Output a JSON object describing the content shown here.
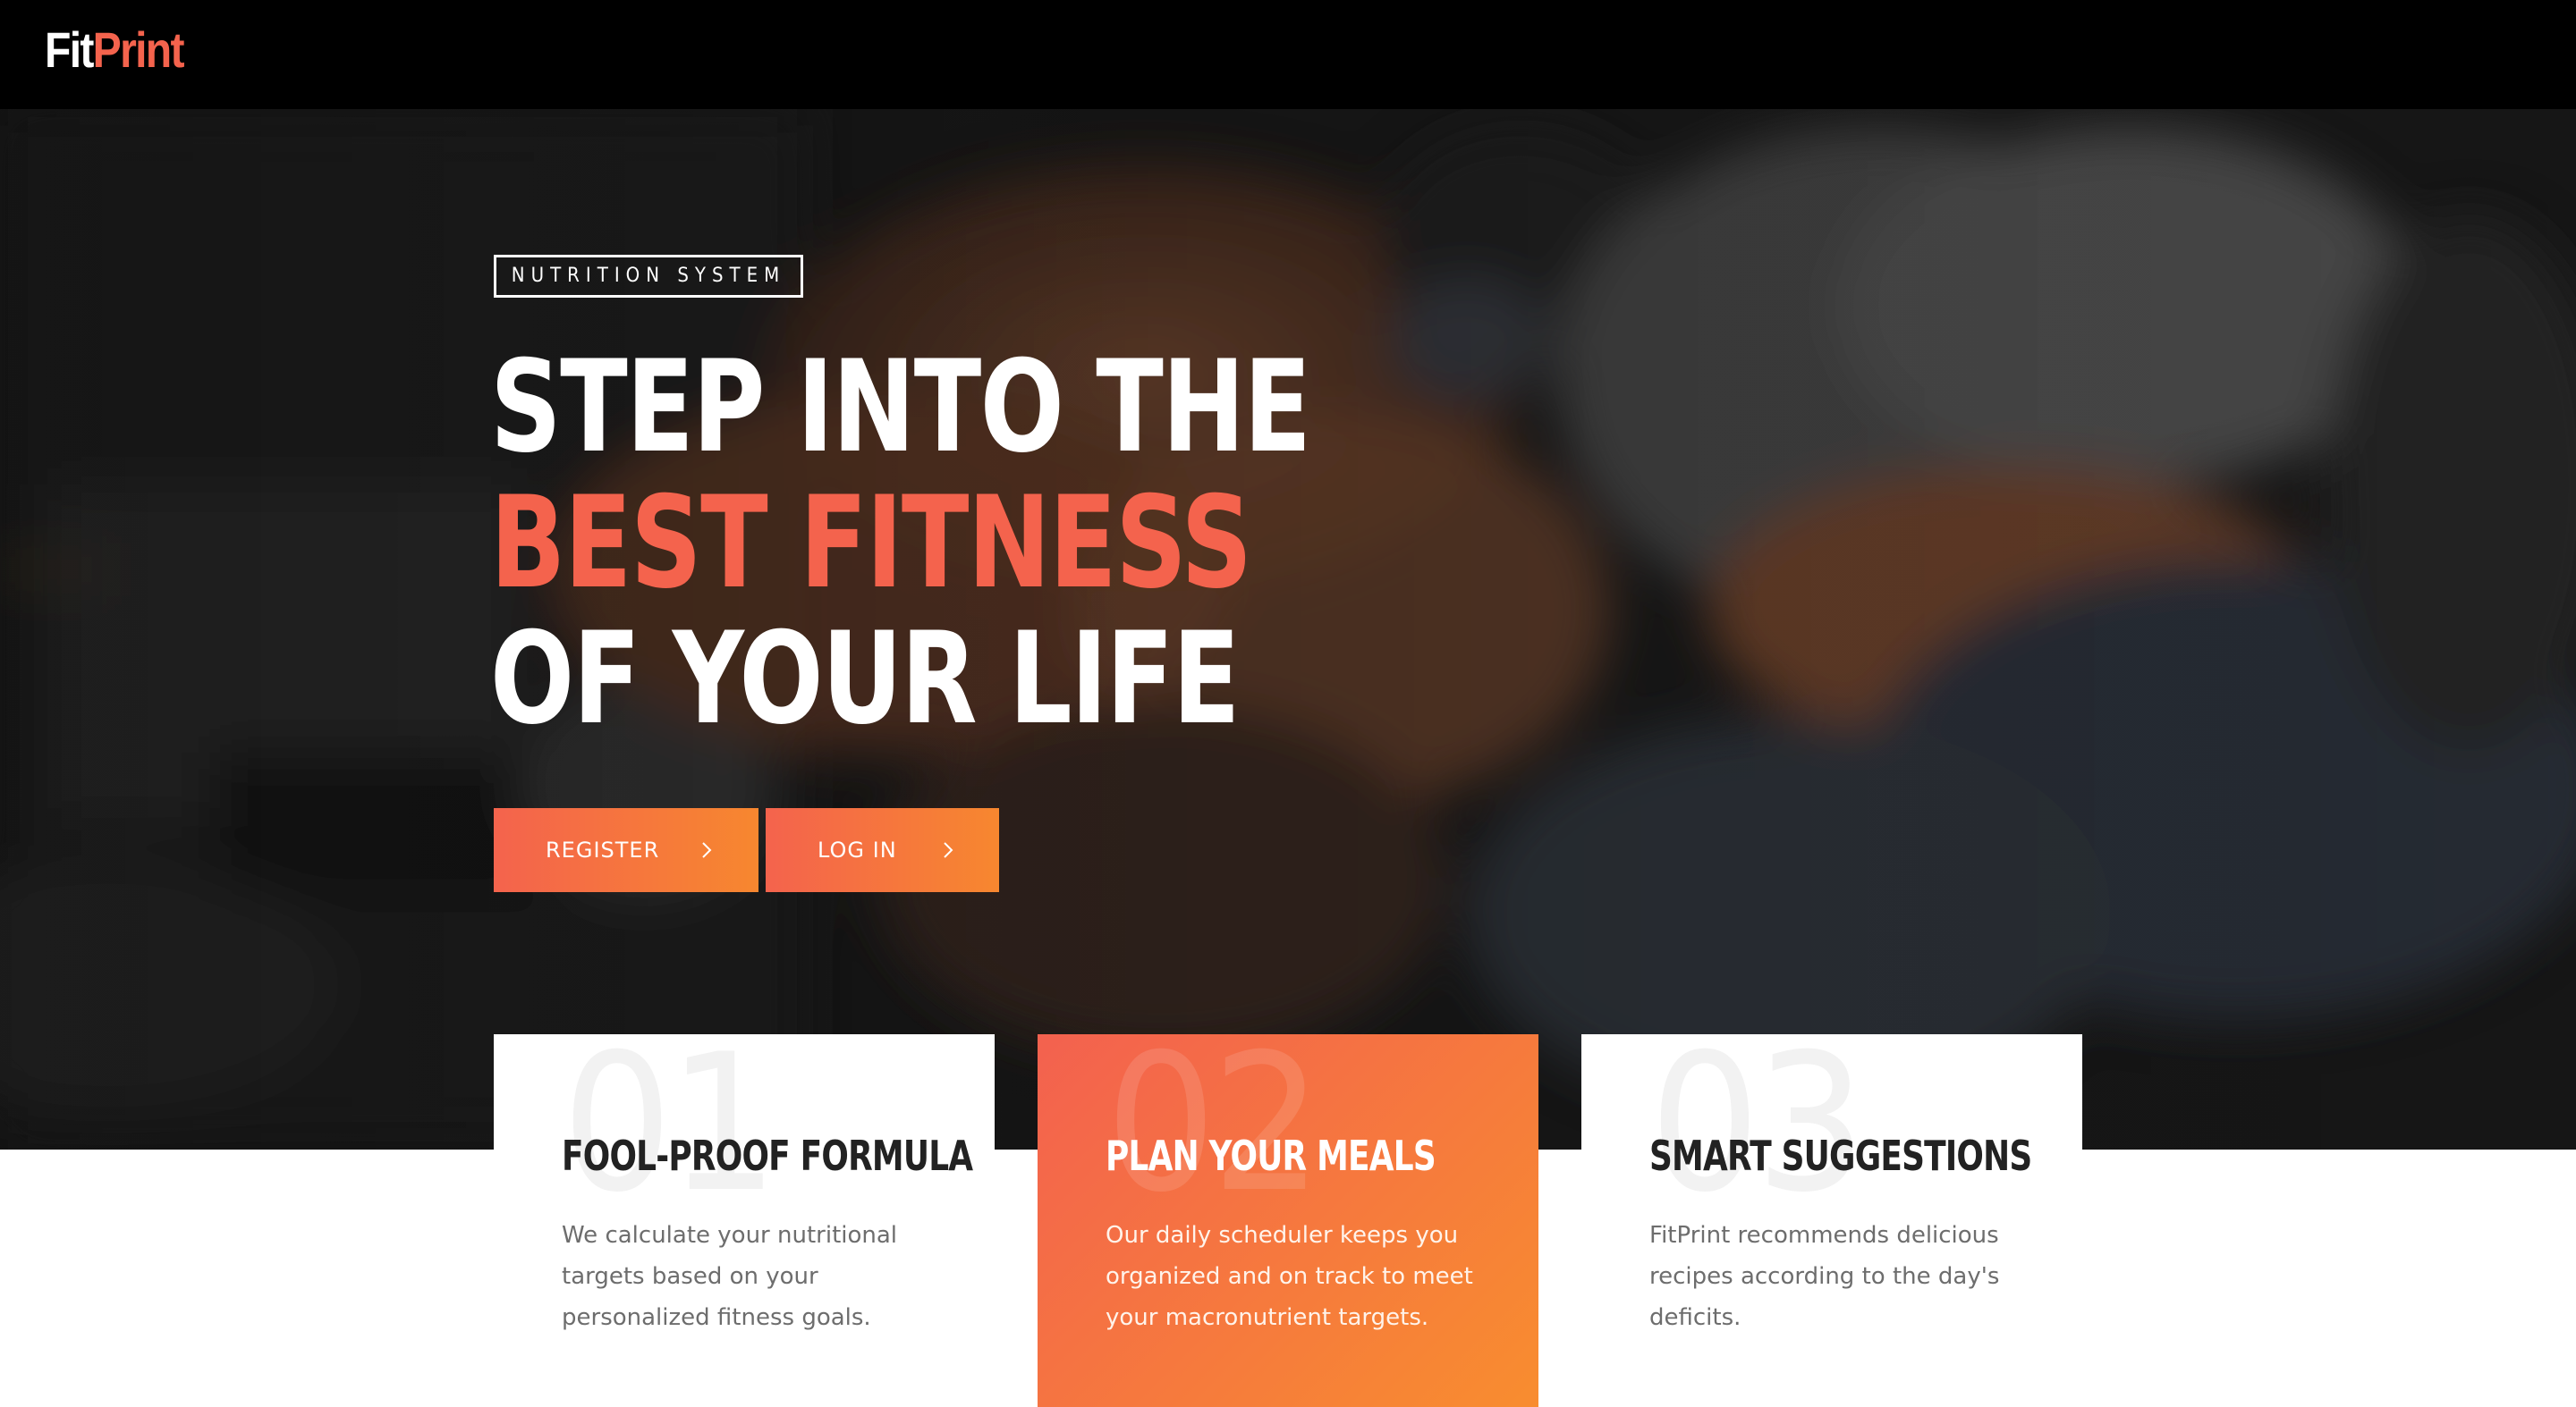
{
  "brand": {
    "logo_part1": "Fit",
    "logo_part2": "Print",
    "accent_color": "#f4634d",
    "gradient_end_color": "#f7872f"
  },
  "hero": {
    "eyebrow": "NUTRITION SYSTEM",
    "headline_line1": "STEP INTO THE",
    "headline_line2": "BEST FITNESS",
    "headline_line3": "OF YOUR LIFE",
    "register_label": "REGISTER",
    "login_label": "LOG IN",
    "button_icon": "chevron-right-icon"
  },
  "features": [
    {
      "number": "01",
      "title": "FOOL-PROOF FORMULA",
      "description": "We calculate your nutritional targets based on your personalized fitness goals."
    },
    {
      "number": "02",
      "title": "PLAN YOUR MEALS",
      "description": "Our daily scheduler keeps you organized and on track to meet your macronutrient targets."
    },
    {
      "number": "03",
      "title": "SMART SUGGESTIONS",
      "description": "FitPrint recommends delicious recipes according to the day's deficits."
    }
  ]
}
